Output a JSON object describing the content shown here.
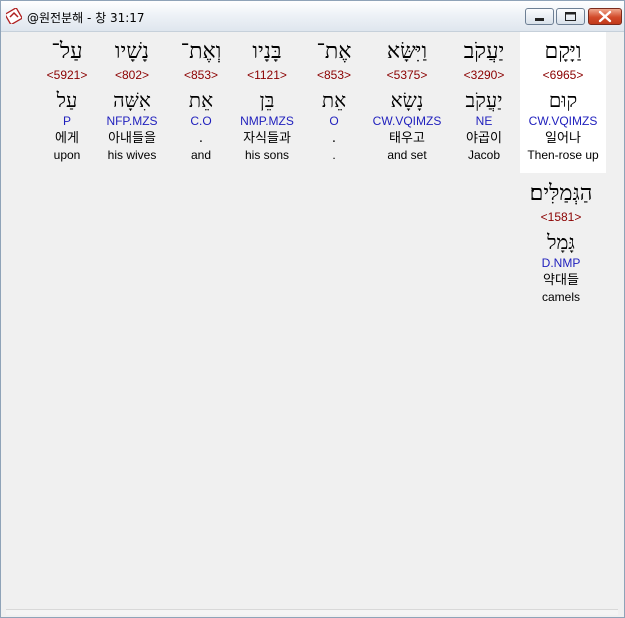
{
  "window": {
    "title": "@원전분해 - 창 31:17",
    "icon": "bible-app-icon",
    "controls": {
      "minimize": "minimize-icon",
      "maximize": "maximize-icon",
      "close": "close-icon"
    }
  },
  "words": [
    {
      "hebrew": "וַיָּקָם",
      "strong": "<6965>",
      "root": "קוּם",
      "parse": "CW.VQIMZS",
      "korean": "일어나",
      "english": "Then-rose up",
      "highlighted": true
    },
    {
      "hebrew": "יַעֲקֹב",
      "strong": "<3290>",
      "root": "יַעֲקֹב",
      "parse": "NE",
      "korean": "야곱이",
      "english": "Jacob"
    },
    {
      "hebrew": "וַיִּשָּׂא",
      "strong": "<5375>",
      "root": "נָשָׂא",
      "parse": "CW.VQIMZS",
      "korean": "태우고",
      "english": "and set"
    },
    {
      "hebrew": "אֶת־",
      "strong": "<853>",
      "root": "אֵת",
      "parse": "O",
      "korean": ".",
      "english": "."
    },
    {
      "hebrew": "בָּנָיו",
      "strong": "<1121>",
      "root": "בֵּן",
      "parse": "NMP.MZS",
      "korean": "자식들과",
      "english": "his sons"
    },
    {
      "hebrew": "וְאֶת־",
      "strong": "<853>",
      "root": "אֵת",
      "parse": "C.O",
      "korean": ".",
      "english": "and"
    },
    {
      "hebrew": "נָשָׁיו",
      "strong": "<802>",
      "root": "אִשָּׁה",
      "parse": "NFP.MZS",
      "korean": "아내들을",
      "english": "his wives"
    },
    {
      "hebrew": "עַל־",
      "strong": "<5921>",
      "root": "עַל",
      "parse": "P",
      "korean": "에게",
      "english": "upon"
    },
    {
      "hebrew": "הַגְּמַלִּים׃",
      "strong": "<1581>",
      "root": "גָּמָל",
      "parse": "D.NMP",
      "korean": "약대들",
      "english": "camels"
    }
  ]
}
